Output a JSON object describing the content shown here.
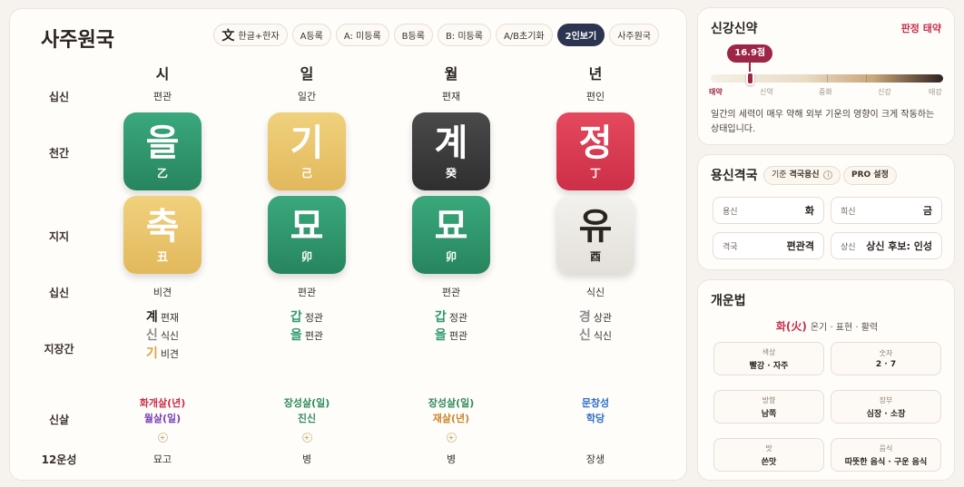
{
  "main": {
    "title": "사주원국",
    "toolbar": [
      {
        "icon": "文",
        "label": "한글+한자"
      },
      {
        "label": "A등록"
      },
      {
        "label": "A: 미등록"
      },
      {
        "label": "B등록"
      },
      {
        "label": "B: 미등록"
      },
      {
        "label": "A/B초기화"
      },
      {
        "label": "2인보기"
      },
      {
        "label": "사주원국"
      }
    ],
    "columns": [
      "시",
      "일",
      "월",
      "년"
    ],
    "row_labels": {
      "sipsin_top": "십신",
      "cheongan": "천간",
      "jiji": "지지",
      "sipsin_bottom": "십신",
      "jijanggan": "지장간",
      "sinsal": "신살",
      "unseong": "12운성"
    },
    "pillars": [
      {
        "sipsin_top": "편관",
        "stem": {
          "hangul": "을",
          "hanja": "乙",
          "color": "#2f9a6e"
        },
        "branch": {
          "hangul": "축",
          "hanja": "丑",
          "color": "#e9c46a"
        },
        "sipsin_bottom": "비견",
        "jijanggan": [
          {
            "char": "계",
            "label": "편재",
            "color": "#2a2420"
          },
          {
            "char": "신",
            "label": "식신",
            "color": "#8c8c8c"
          },
          {
            "char": "기",
            "label": "비견",
            "color": "#d9a441"
          }
        ],
        "sinsal": [
          {
            "text": "화개살(년)",
            "color": "#c92f4a"
          },
          {
            "text": "월살(일)",
            "color": "#7a3fb5"
          }
        ],
        "unseong": "묘고"
      },
      {
        "sipsin_top": "일간",
        "stem": {
          "hangul": "기",
          "hanja": "己",
          "color": "#e9c46a"
        },
        "branch": {
          "hangul": "묘",
          "hanja": "卯",
          "color": "#2f9a6e"
        },
        "sipsin_bottom": "편관",
        "jijanggan": [
          {
            "char": "갑",
            "label": "정관",
            "color": "#2f9a6e"
          },
          {
            "char": "을",
            "label": "편관",
            "color": "#2f9a6e"
          }
        ],
        "sinsal": [
          {
            "text": "장성살(일)",
            "color": "#2f8a5e"
          },
          {
            "text": "진신",
            "color": "#2f8a5e"
          }
        ],
        "unseong": "병"
      },
      {
        "sipsin_top": "편재",
        "stem": {
          "hangul": "계",
          "hanja": "癸",
          "color": "#3a3a3a"
        },
        "branch": {
          "hangul": "묘",
          "hanja": "卯",
          "color": "#2f9a6e"
        },
        "sipsin_bottom": "편관",
        "jijanggan": [
          {
            "char": "갑",
            "label": "정관",
            "color": "#2f9a6e"
          },
          {
            "char": "을",
            "label": "편관",
            "color": "#2f9a6e"
          }
        ],
        "sinsal": [
          {
            "text": "장성살(일)",
            "color": "#2f8a5e"
          },
          {
            "text": "재살(년)",
            "color": "#c8862f"
          }
        ],
        "unseong": "병"
      },
      {
        "sipsin_top": "편인",
        "stem": {
          "hangul": "정",
          "hanja": "丁",
          "color": "#d63a52"
        },
        "branch": {
          "hangul": "유",
          "hanja": "酉",
          "color": "#ecebe7"
        },
        "sipsin_bottom": "식신",
        "jijanggan": [
          {
            "char": "경",
            "label": "상관",
            "color": "#8c8c8c"
          },
          {
            "char": "신",
            "label": "식신",
            "color": "#8c8c8c"
          }
        ],
        "sinsal": [
          {
            "text": "문창성",
            "color": "#2f6fc9"
          },
          {
            "text": "학당",
            "color": "#2f6fc9"
          }
        ],
        "unseong": "장생"
      }
    ]
  },
  "strength": {
    "title": "신강신약",
    "verdict": "판정 태약",
    "score_label": "16.9점",
    "score_fraction": 0.169,
    "scale_labels": [
      "태약",
      "신약",
      "중화",
      "신강",
      "태강"
    ],
    "current_index": 0,
    "description": "일간의 세력이 매우 약해 외부 기운의 영향이 크게 작동하는 상태입니다."
  },
  "yongsin": {
    "title": "용신격국",
    "criteria_label": "기준",
    "criteria_value": "격국용신",
    "pro_label": "PRO 설정",
    "items": [
      {
        "key": "용신",
        "value": "화"
      },
      {
        "key": "희신",
        "value": "금"
      },
      {
        "key": "격국",
        "value": "편관격"
      },
      {
        "key": "상신",
        "value": "상신 후보: 인성"
      }
    ]
  },
  "gaeun": {
    "title": "개운법",
    "element": "화(火)",
    "element_desc": "온기 · 표현 · 활력",
    "items": [
      {
        "key": "색상",
        "value": "빨강 · 자주"
      },
      {
        "key": "숫자",
        "value": "2 · 7"
      },
      {
        "key": "방향",
        "value": "남쪽"
      },
      {
        "key": "장부",
        "value": "심장 · 소장"
      },
      {
        "key": "맛",
        "value": "쓴맛"
      },
      {
        "key": "음식",
        "value": "따뜻한 음식 · 구운 음식"
      }
    ]
  }
}
